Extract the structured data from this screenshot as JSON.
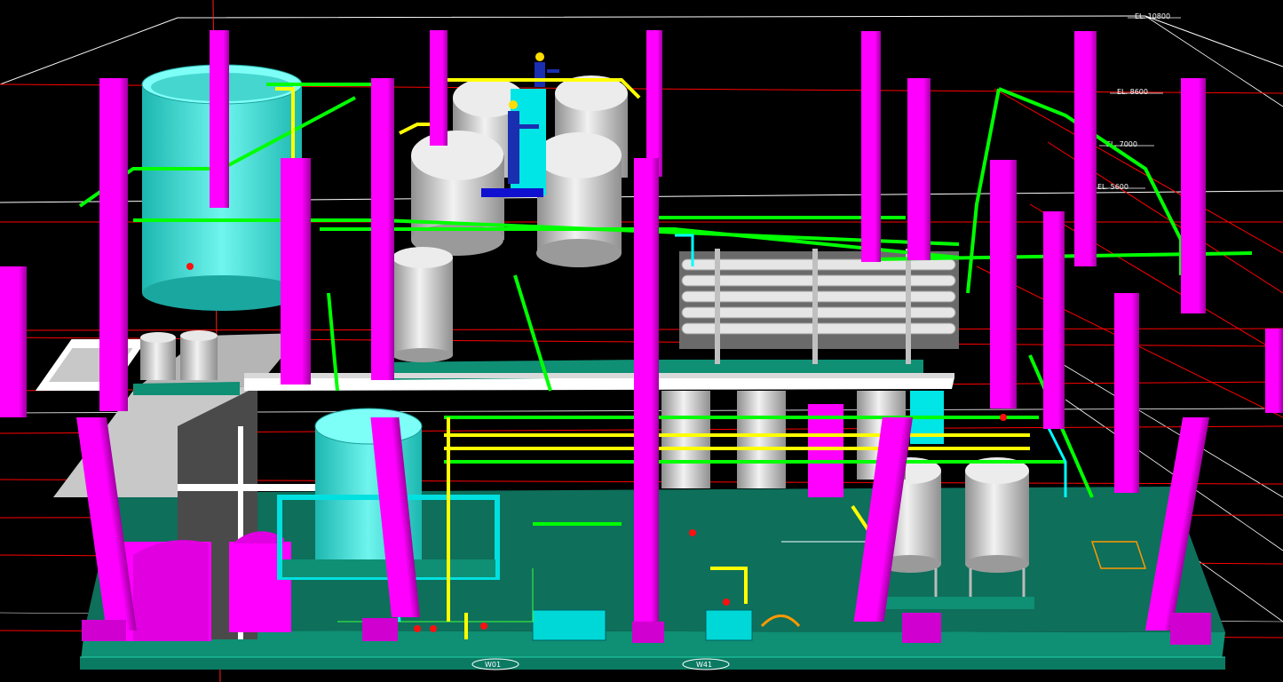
{
  "viewport": {
    "background": "#000000",
    "elevations": [
      "EL. 10800",
      "EL. 8600",
      "EL. 7000",
      "EL. 5600"
    ],
    "equipment_tags": [
      "W01",
      "W41"
    ]
  },
  "colors": {
    "column": "#ff00ff",
    "column_dark": "#b000b0",
    "slab": "#0f8f74",
    "slab_light": "#17a88a",
    "pipe_green": "#00ff00",
    "pipe_yellow": "#ffff00",
    "pipe_cyan": "#00ffff",
    "vessel": "#d8d8d8",
    "vessel_shade": "#9a9a9a",
    "tank_cyan": "#33e0d8",
    "platform_gray": "#c8c8c8",
    "grid_red": "#ff0000",
    "grid_white": "#ffffff"
  },
  "icons": [
    "worker-figure-icon",
    "elevation-marker-icon",
    "red-valve-icon"
  ]
}
